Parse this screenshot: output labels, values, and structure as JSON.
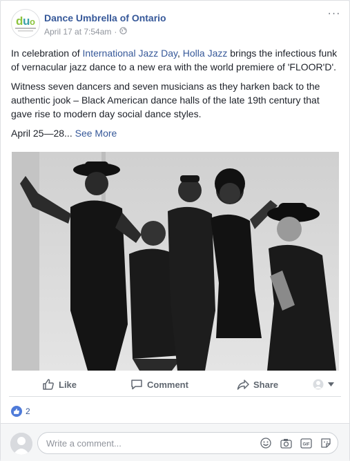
{
  "post": {
    "page_name": "Dance Umbrella of Ontario",
    "logo_text": "DANCE UMBRELLA ONTARIO",
    "date": "April 17 at 7:54am",
    "separator": "·",
    "menu": "···",
    "para1_prefix": "In celebration of ",
    "link1": "International Jazz Day",
    "para1_comma": ", ",
    "link2": "Holla Jazz",
    "para1_rest": " brings the infectious funk of vernacular jazz dance to a new era with the world premiere of 'FLOOR'D'.",
    "para2": "Witness seven dancers and seven musicians as they harken back to the authentic jook – Black American dance halls of the late 19th century that gave rise to modern day social dance styles.",
    "para3_prefix": "April 25—28... ",
    "see_more": "See More"
  },
  "actions": {
    "like": "Like",
    "comment": "Comment",
    "share": "Share"
  },
  "reactions": {
    "count": "2"
  },
  "comment": {
    "placeholder": "Write a comment..."
  },
  "icons": {
    "globe": "globe-icon",
    "like": "thumbs-up-icon",
    "comment": "speech-bubble-icon",
    "share": "share-arrow-icon",
    "emoji": "smiley-icon",
    "camera": "camera-icon",
    "gif": "gif-icon",
    "sticker": "sticker-icon"
  },
  "colors": {
    "link": "#365899",
    "like_blue": "#4f7bd9",
    "muted": "#90949c"
  }
}
